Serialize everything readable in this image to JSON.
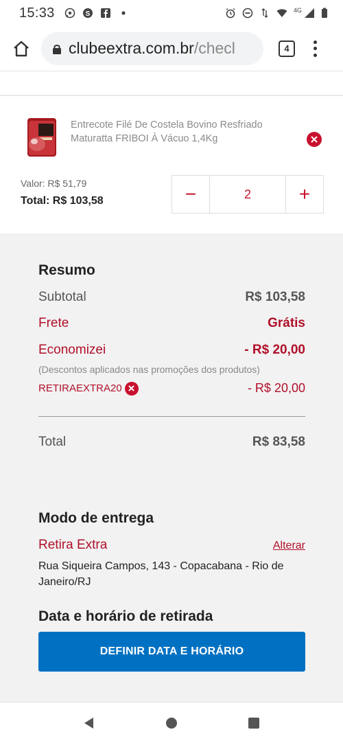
{
  "status_bar": {
    "time": "15:33",
    "network": "4G"
  },
  "browser": {
    "url_host": "clubeextra.com.br",
    "url_path": "/checl",
    "tab_count": "4"
  },
  "product": {
    "name": "Entrecote Filé De Costela Bovino Resfriado Maturatta FRIBOI À Vácuo 1,4Kg",
    "unit_price": "Valor: R$ 51,79",
    "total": "Total: R$ 103,58",
    "quantity": "2",
    "minus": "−",
    "plus": "+"
  },
  "summary": {
    "title": "Resumo",
    "subtotal_label": "Subtotal",
    "subtotal_value": "R$ 103,58",
    "shipping_label": "Frete",
    "shipping_value": "Grátis",
    "saved_label": "Economizei",
    "saved_value": "- R$ 20,00",
    "saved_note": "(Descontos aplicados nas promoções dos produtos)",
    "coupon_code": "RETIRAEXTRA20",
    "coupon_value": "- R$ 20,00",
    "total_label": "Total",
    "total_value": "R$ 83,58"
  },
  "delivery": {
    "title": "Modo de entrega",
    "mode": "Retira Extra",
    "change_link": "Alterar",
    "address": "Rua Siqueira Campos, 143 - Copacabana - Rio de Janeiro/RJ"
  },
  "pickup": {
    "title": "Data e horário de retirada",
    "button_label": "DEFINIR DATA E HORÁRIO"
  },
  "colors": {
    "brand_red": "#b0102a",
    "button_blue": "#0071c2",
    "summary_bg": "#f2f2f2"
  }
}
